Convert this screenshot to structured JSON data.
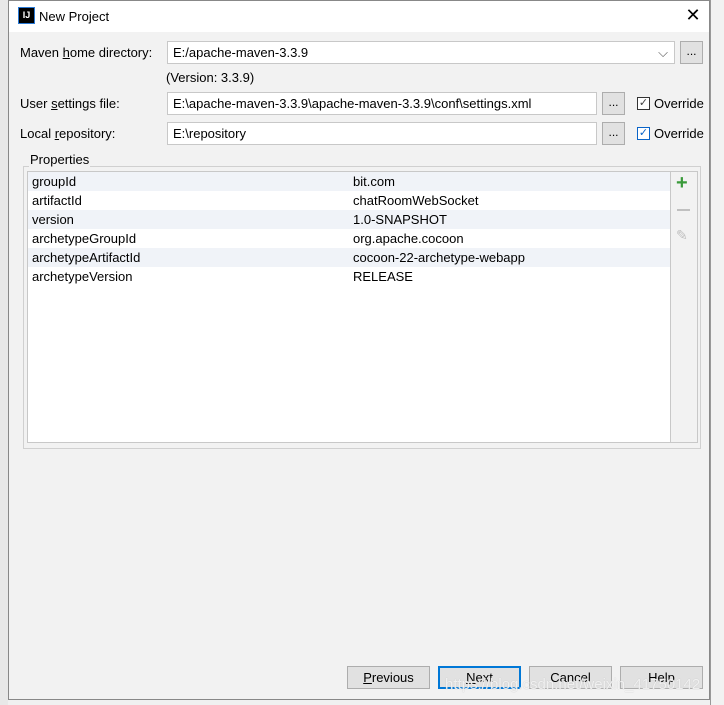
{
  "window": {
    "title": "New Project",
    "logo": "IJ"
  },
  "maven_home": {
    "label": "Maven home directory:",
    "value": "E:/apache-maven-3.3.9",
    "version": "(Version: 3.3.9)"
  },
  "user_settings": {
    "label": "User settings file:",
    "value": "E:\\apache-maven-3.3.9\\apache-maven-3.3.9\\conf\\settings.xml",
    "override": "Override",
    "checked": true
  },
  "local_repo": {
    "label": "Local repository:",
    "value": "E:\\repository",
    "override": "Override",
    "checked": true
  },
  "browse_label": "...",
  "properties": {
    "label": "Properties",
    "rows": [
      {
        "key": "groupId",
        "value": "bit.com"
      },
      {
        "key": "artifactId",
        "value": "chatRoomWebSocket"
      },
      {
        "key": "version",
        "value": "1.0-SNAPSHOT"
      },
      {
        "key": "archetypeGroupId",
        "value": "org.apache.cocoon"
      },
      {
        "key": "archetypeArtifactId",
        "value": "cocoon-22-archetype-webapp"
      },
      {
        "key": "archetypeVersion",
        "value": "RELEASE"
      }
    ]
  },
  "buttons": {
    "previous": "Previous",
    "next": "Next",
    "cancel": "Cancel",
    "help": "Help"
  },
  "watermark": "https://blog.csdn.net/weixin_41750142",
  "colors": {
    "accent": "#0078d7",
    "add": "#3a9a3a"
  }
}
